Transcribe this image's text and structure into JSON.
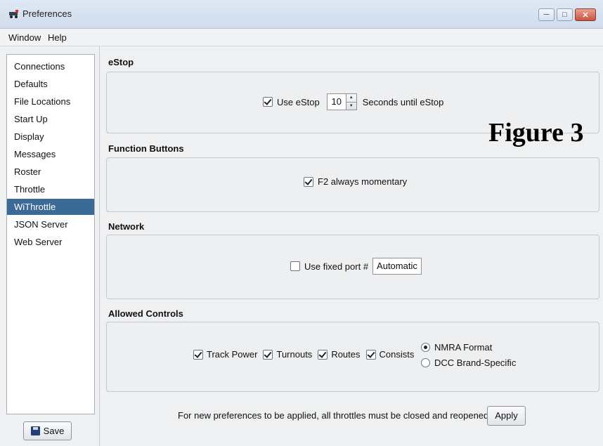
{
  "window": {
    "title": "Preferences"
  },
  "menu": {
    "items": [
      "Window",
      "Help"
    ]
  },
  "sidebar": {
    "items": [
      {
        "label": "Connections"
      },
      {
        "label": "Defaults"
      },
      {
        "label": "File Locations"
      },
      {
        "label": "Start Up"
      },
      {
        "label": "Display"
      },
      {
        "label": "Messages"
      },
      {
        "label": "Roster"
      },
      {
        "label": "Throttle"
      },
      {
        "label": "WiThrottle",
        "selected": true
      },
      {
        "label": "JSON Server"
      },
      {
        "label": "Web Server"
      }
    ],
    "save_label": "Save"
  },
  "estop": {
    "title": "eStop",
    "use_label": "Use eStop",
    "use_checked": true,
    "seconds_value": "10",
    "seconds_label": "Seconds until eStop"
  },
  "function_buttons": {
    "title": "Function Buttons",
    "f2_label": "F2 always momentary",
    "f2_checked": true
  },
  "network": {
    "title": "Network",
    "fixed_port_label": "Use fixed port #",
    "fixed_port_checked": false,
    "port_value": "Automatic"
  },
  "allowed_controls": {
    "title": "Allowed Controls",
    "track_power": "Track Power",
    "turnouts": "Turnouts",
    "routes": "Routes",
    "consists": "Consists",
    "nmra_format": "NMRA Format",
    "dcc_brand": "DCC Brand-Specific",
    "selected_format": "NMRA Format"
  },
  "footer": {
    "note": "For new preferences to be applied, all throttles must be closed and reopened.",
    "apply_label": "Apply"
  },
  "overlay": {
    "figure_label": "Figure 3"
  }
}
